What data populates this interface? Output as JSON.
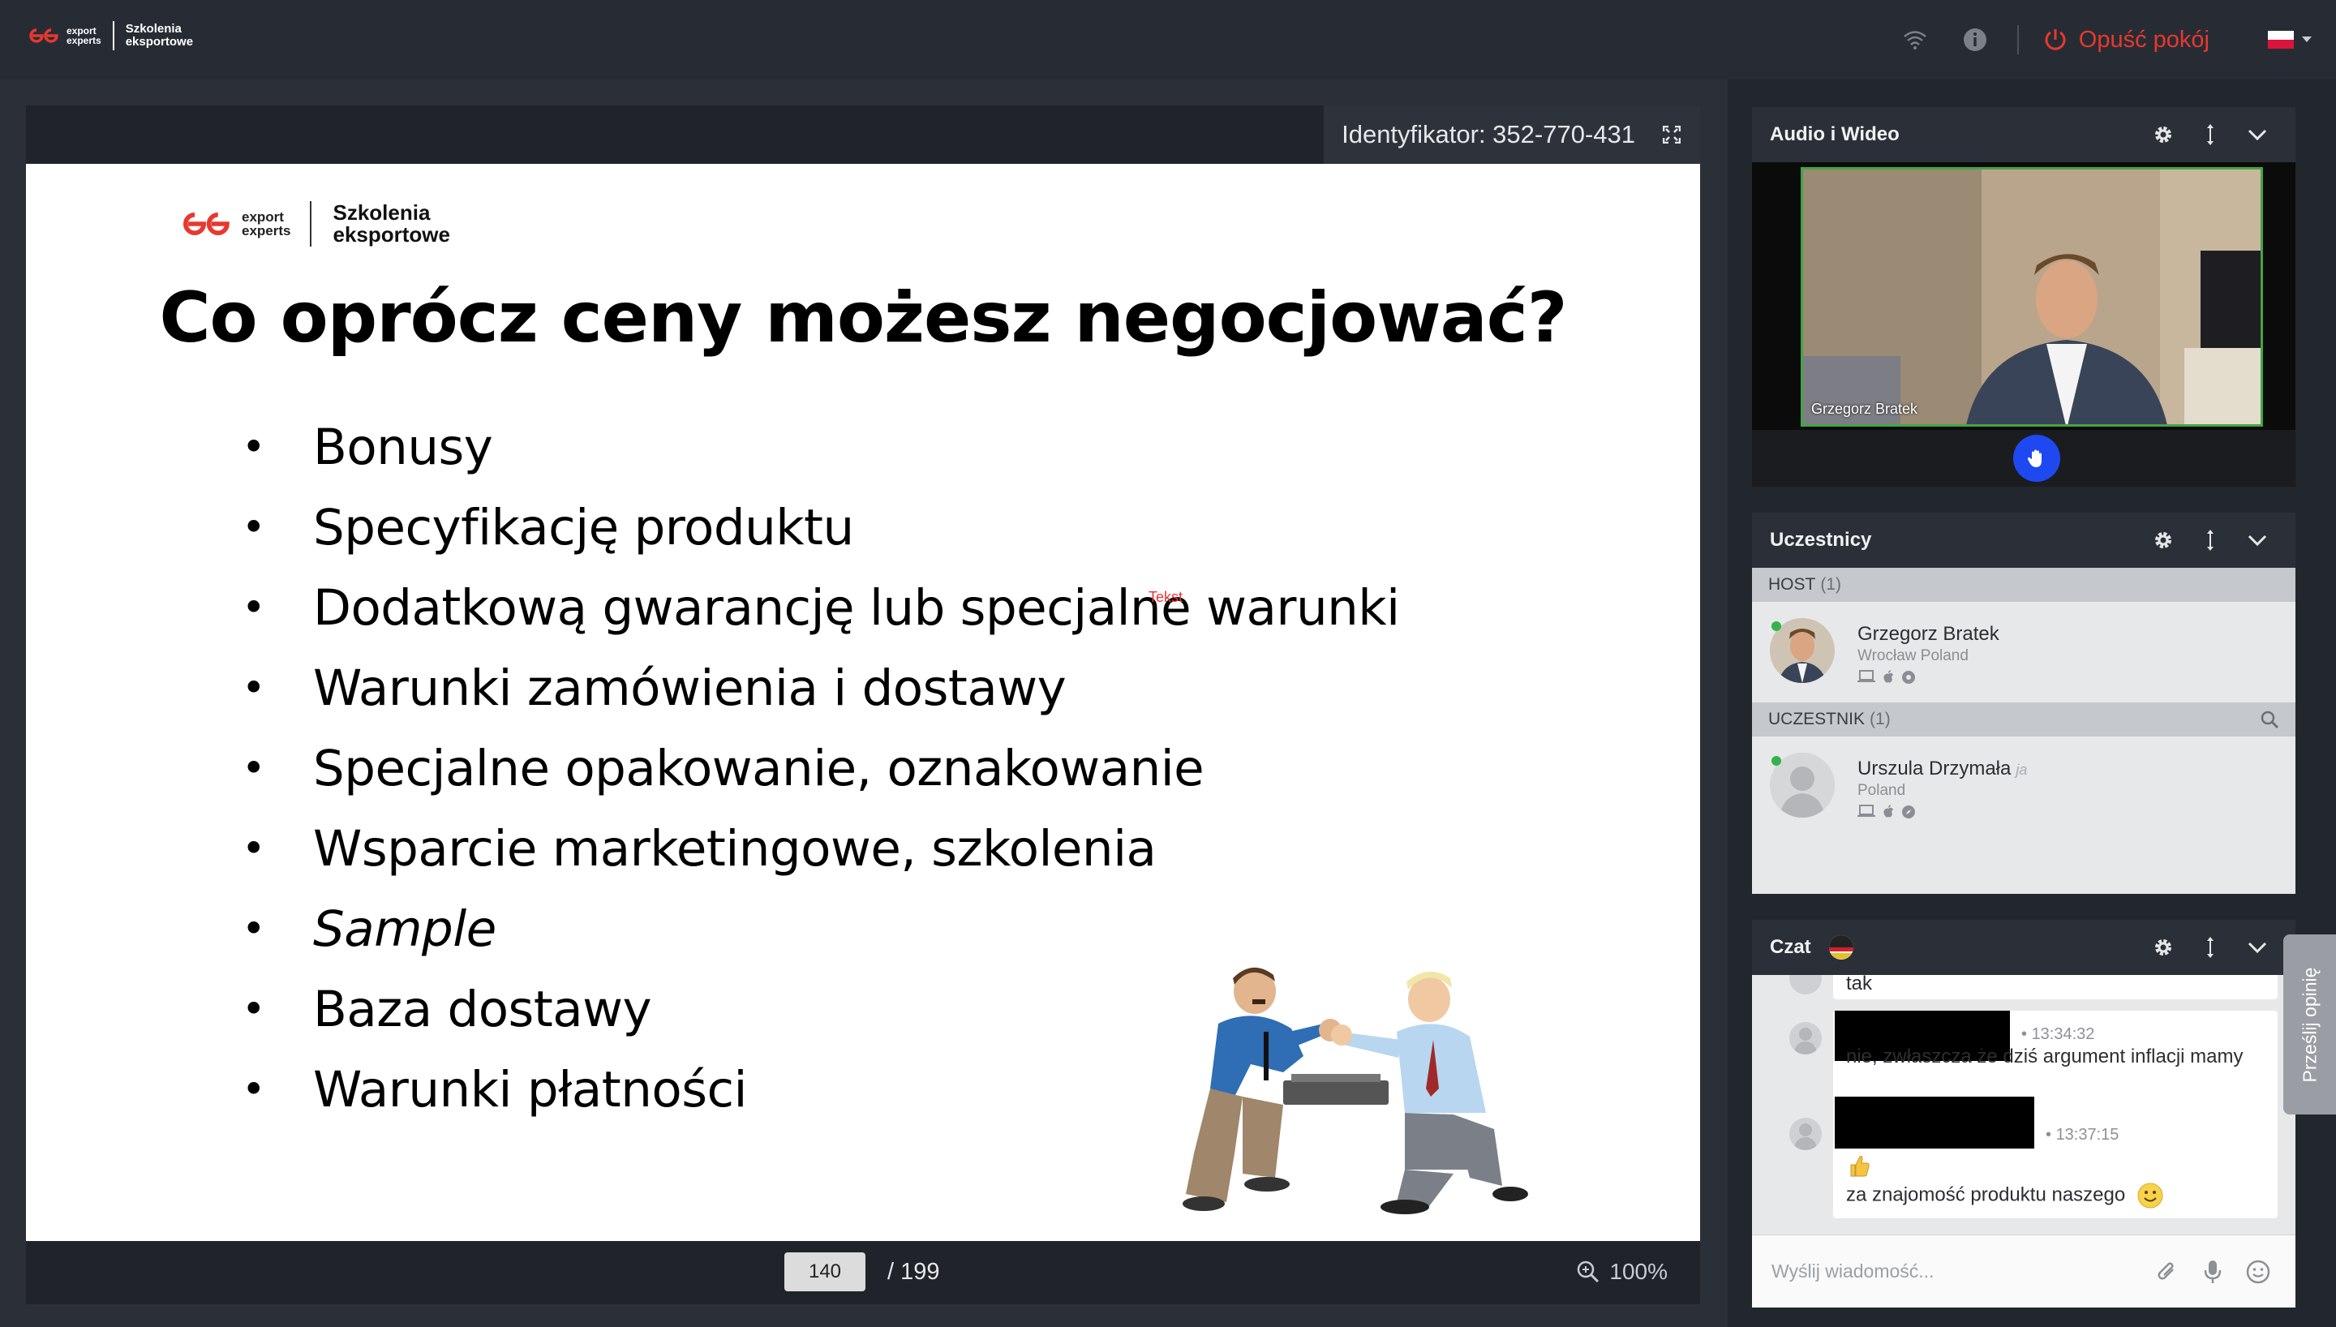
{
  "app": {
    "logo_small_line1": "export",
    "logo_small_line2": "experts",
    "logo_title_line1": "Szkolenia",
    "logo_title_line2": "eksportowe",
    "leave_label": "Opuść pokój",
    "language_flag": "poland-flag-icon"
  },
  "presentation": {
    "identifier": "Identyfikator: 352-770-431",
    "slide": {
      "logo_small_line1": "export",
      "logo_small_line2": "experts",
      "logo_title_line1": "Szkolenia",
      "logo_title_line2": "eksportowe",
      "title": "Co oprócz ceny możesz negocjować?",
      "bullets": [
        "Bonusy",
        "Specyfikację produktu",
        "Dodatkową gwarancję lub specjalne warunki",
        "Warunki zamówienia i dostawy",
        "Specjalne opakowanie, oznakowanie",
        "Wsparcie marketingowe, szkolenia",
        "Sample",
        "Baza dostawy",
        "Warunki płatności"
      ],
      "cursor_label": "Tekst"
    },
    "footer": {
      "current_page": "140",
      "total_pages": "/ 199",
      "zoom": "100%"
    }
  },
  "audio_video": {
    "title": "Audio i Wideo",
    "video_name": "Grzegorz Bratek"
  },
  "participants": {
    "title": "Uczestnicy",
    "host_label": "HOST",
    "host_count": "(1)",
    "host": {
      "name": "Grzegorz Bratek",
      "location": "Wrocław Poland"
    },
    "participant_label": "UCZESTNIK",
    "participant_count": "(1)",
    "participant": {
      "name": "Urszula Drzymała",
      "me_marker": "ja",
      "location": "Poland"
    }
  },
  "chat": {
    "title": "Czat",
    "messages": [
      {
        "time": "",
        "text": "tak"
      },
      {
        "time": "13:34:32",
        "text": "nie, zwłaszcza że dziś argument inflacji mamy"
      },
      {
        "time": "13:37:15",
        "text": "za znajomość produktu naszego"
      }
    ],
    "input_placeholder": "Wyślij wiadomość..."
  },
  "feedback": {
    "label": "Prześlij opinię"
  },
  "colors": {
    "accent_red": "#e8382f",
    "video_border": "#43a543",
    "raise_hand_blue": "#1f49f0"
  }
}
